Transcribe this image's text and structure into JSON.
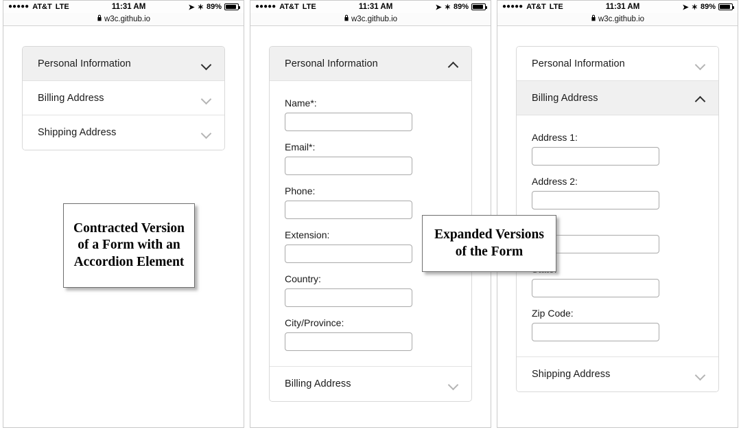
{
  "statusbar": {
    "signal_dots": "●●●●●",
    "carrier": "AT&T",
    "network": "LTE",
    "time": "11:31 AM",
    "location_icon": "➤",
    "bluetooth_icon": "✶",
    "battery_text": "89%",
    "battery_level": 89
  },
  "urlbar": {
    "lock_icon": "🔒",
    "url": "w3c.github.io"
  },
  "labels": {
    "personal_information": "Personal Information",
    "billing_address": "Billing Address",
    "shipping_address": "Shipping Address"
  },
  "phone1": {
    "rows": [
      {
        "title": "Personal Information",
        "state": "collapsed-active",
        "chevron": "chevron-down"
      },
      {
        "title": "Billing Address",
        "state": "collapsed",
        "chevron": "chevron-down"
      },
      {
        "title": "Shipping Address",
        "state": "collapsed",
        "chevron": "chevron-down"
      }
    ]
  },
  "phone2": {
    "header": {
      "title": "Personal Information",
      "state": "expanded",
      "chevron": "chevron-up"
    },
    "fields": [
      {
        "label": "Name*:",
        "value": "",
        "placeholder": ""
      },
      {
        "label": "Email*:",
        "value": "",
        "placeholder": ""
      },
      {
        "label": "Phone:",
        "value": "",
        "placeholder": ""
      },
      {
        "label": "Extension:",
        "value": "",
        "placeholder": ""
      },
      {
        "label": "Country:",
        "value": "",
        "placeholder": ""
      },
      {
        "label": "City/Province:",
        "value": "",
        "placeholder": ""
      }
    ],
    "footer_row": {
      "title": "Billing Address",
      "state": "collapsed",
      "chevron": "chevron-down"
    }
  },
  "phone3": {
    "top_row": {
      "title": "Personal Information",
      "state": "collapsed",
      "chevron": "chevron-down"
    },
    "header": {
      "title": "Billing Address",
      "state": "expanded",
      "chevron": "chevron-up"
    },
    "fields": [
      {
        "label": "Address 1:",
        "value": "",
        "placeholder": ""
      },
      {
        "label": "Address 2:",
        "value": "",
        "placeholder": ""
      },
      {
        "label": "",
        "value": "",
        "placeholder": ""
      },
      {
        "label": "State:",
        "value": "",
        "placeholder": ""
      },
      {
        "label": "Zip Code:",
        "value": "",
        "placeholder": ""
      }
    ],
    "footer_row": {
      "title": "Shipping Address",
      "state": "collapsed",
      "chevron": "chevron-down"
    }
  },
  "callouts": {
    "contracted": "Contracted Version of a Form with an Accordion Element",
    "expanded": "Expanded Versions of the Form"
  },
  "colors": {
    "header_active_bg": "#f0f0f0",
    "panel_border": "#d8d8d8",
    "input_border": "#a9a9a9",
    "text": "#1a1a1a",
    "chevron_muted": "#b4b4b4",
    "chevron_dark": "#2e2e2e"
  }
}
